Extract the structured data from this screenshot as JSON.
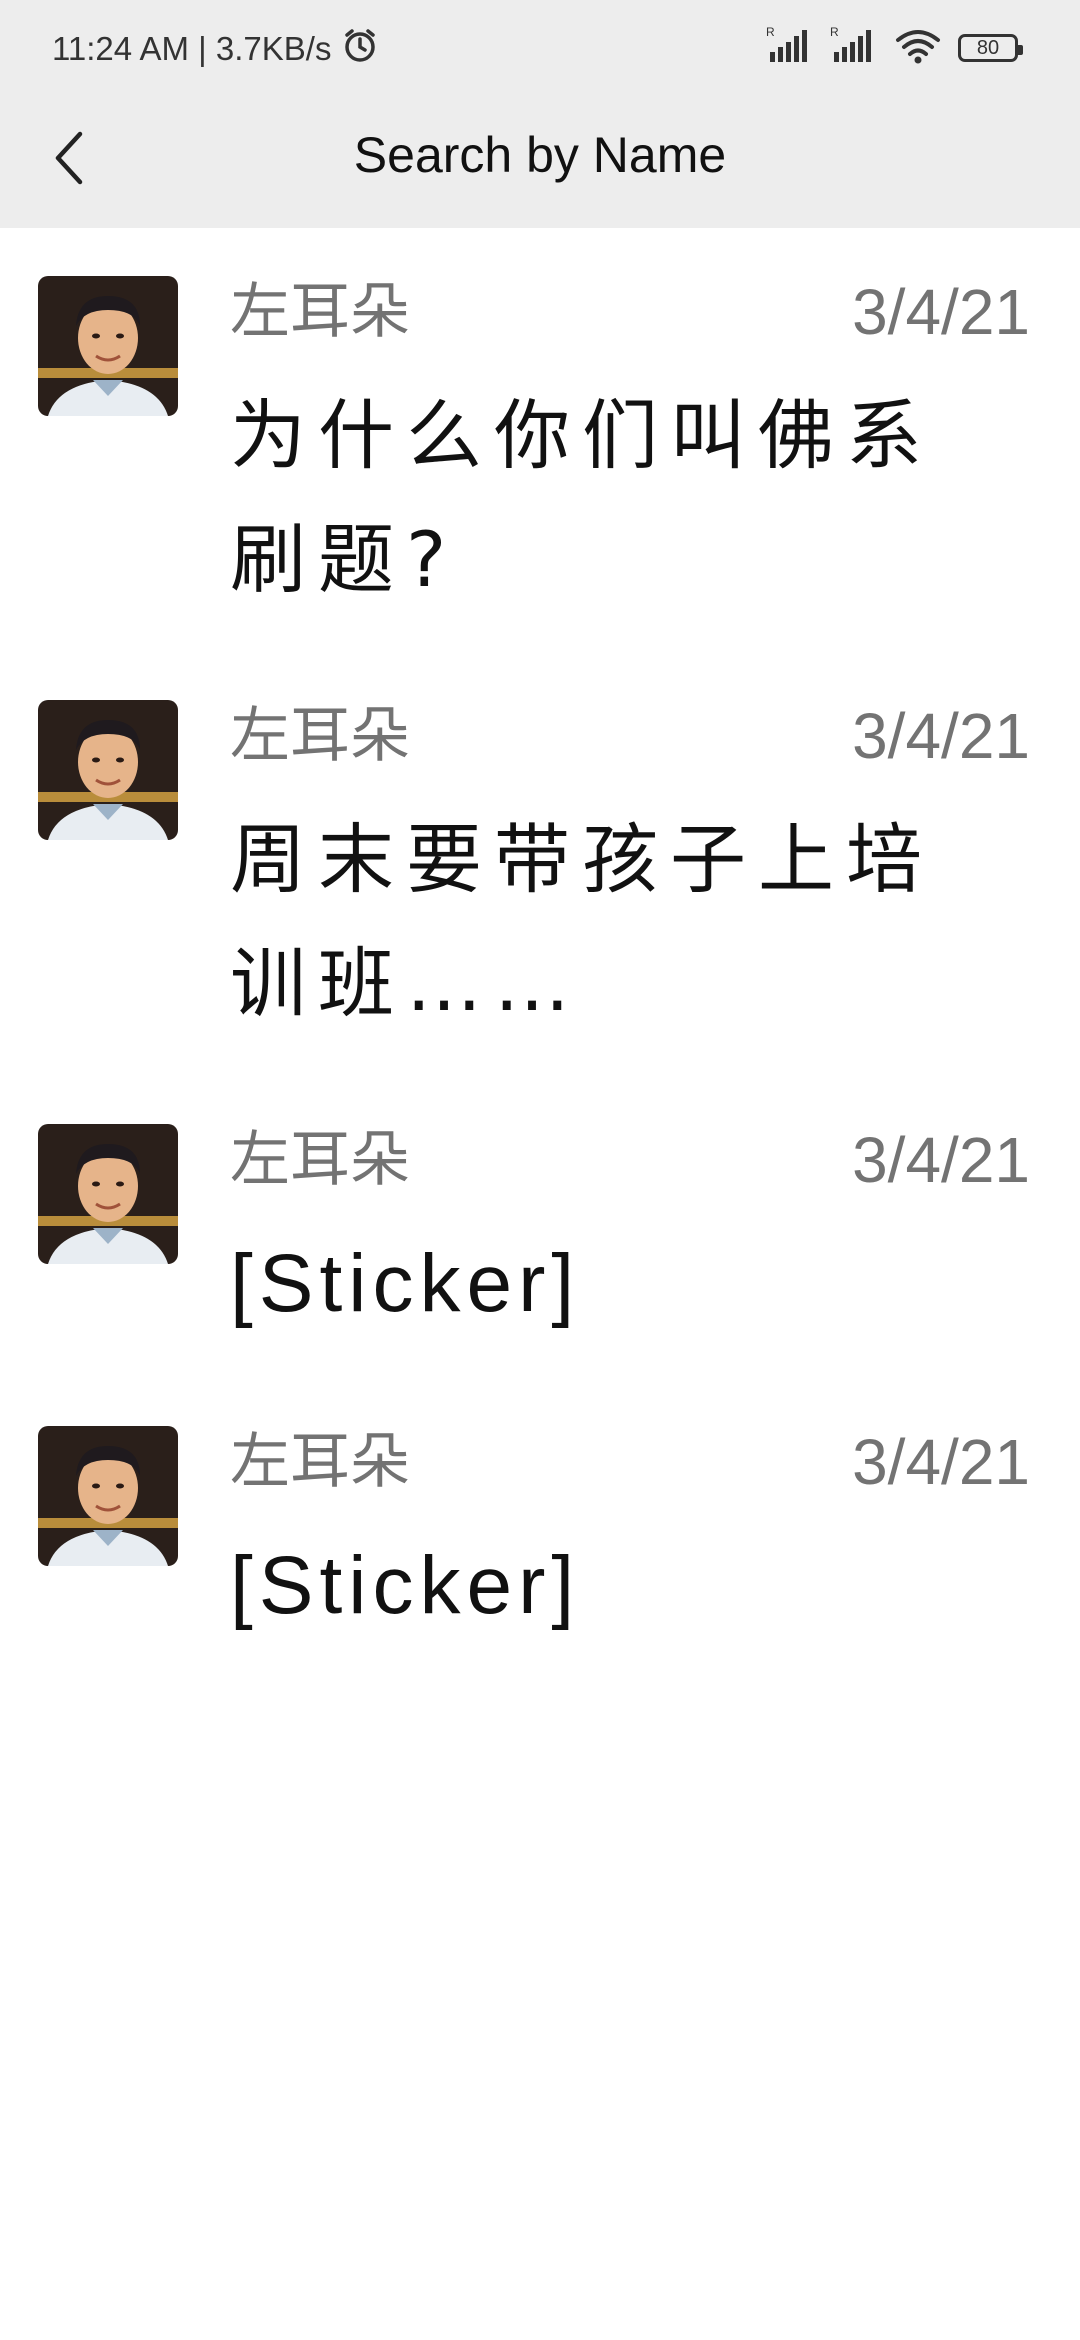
{
  "status_bar": {
    "time_speed": "11:24 AM | 3.7KB/s",
    "signal_1_label": "R",
    "signal_2_label": "R",
    "battery": "80"
  },
  "nav": {
    "title": "Search by Name"
  },
  "results": [
    {
      "sender": "左耳朵",
      "date": "3/4/21",
      "message": "为什么你们叫佛系刷题?"
    },
    {
      "sender": "左耳朵",
      "date": "3/4/21",
      "message": "周末要带孩子上培训班……"
    },
    {
      "sender": "左耳朵",
      "date": "3/4/21",
      "message": "[Sticker]"
    },
    {
      "sender": "左耳朵",
      "date": "3/4/21",
      "message": "[Sticker]"
    }
  ],
  "icons": {
    "back": "chevron-left-icon",
    "alarm": "alarm-icon",
    "signal": "signal-icon",
    "wifi": "wifi-icon",
    "battery": "battery-icon"
  }
}
